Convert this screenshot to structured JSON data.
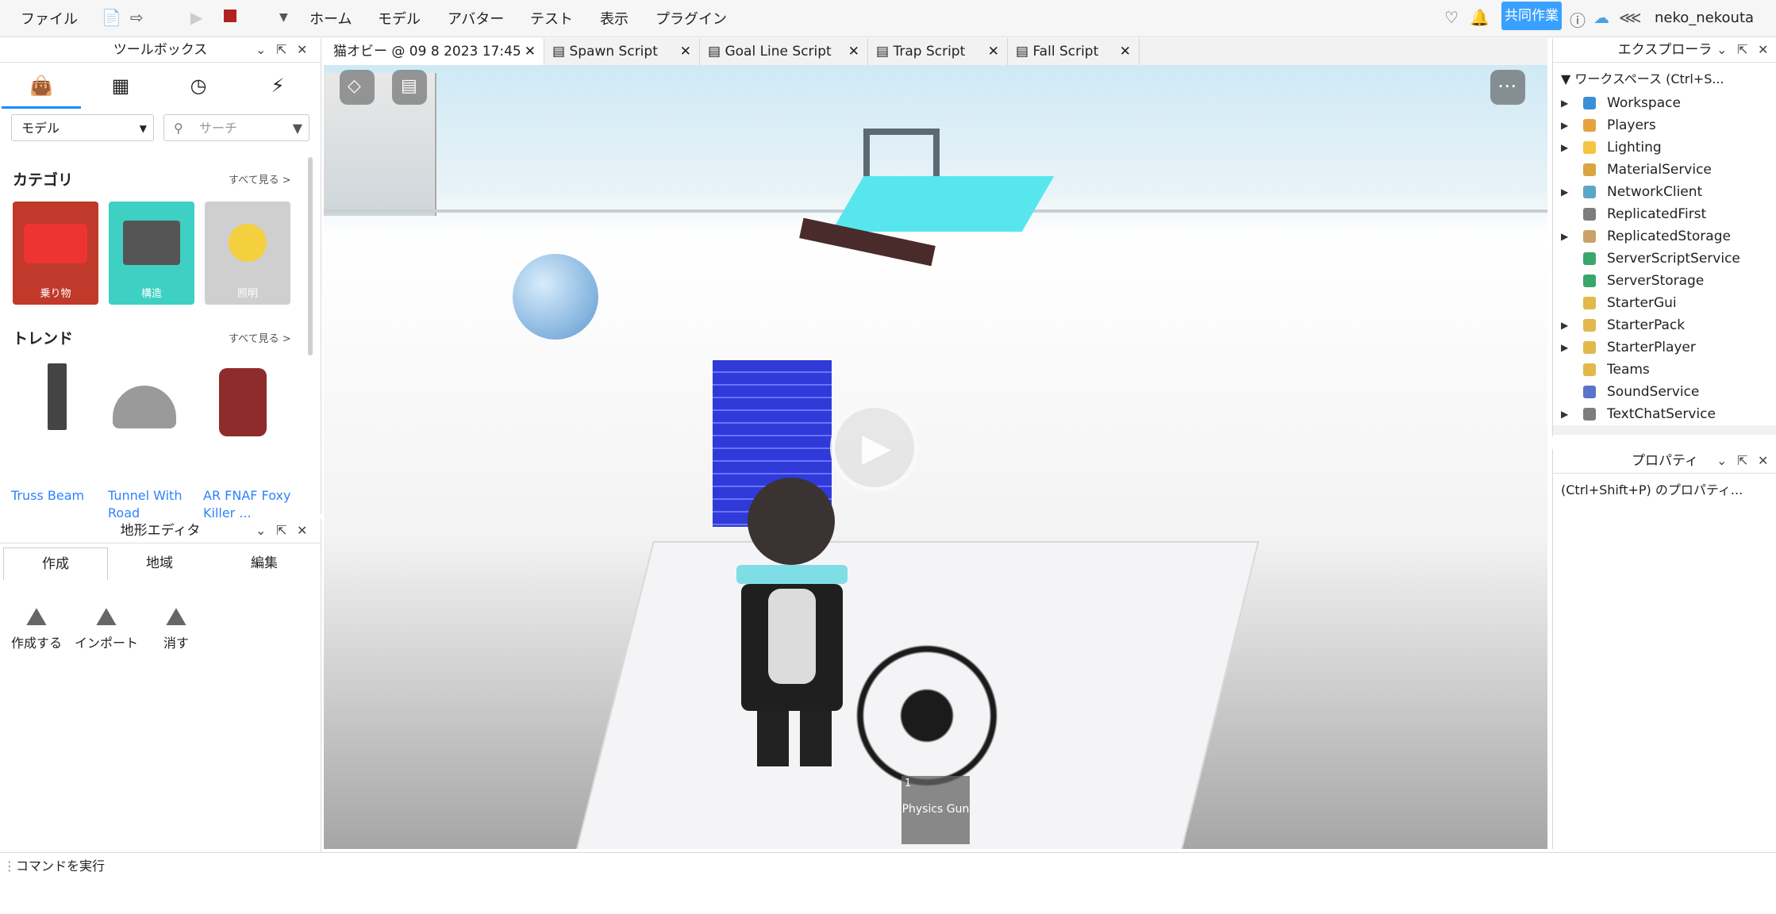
{
  "menu": {
    "file": "ファイル",
    "items": [
      "ホーム",
      "モデル",
      "アバター",
      "テスト",
      "表示",
      "プラグイン"
    ],
    "collab_button": "共同作業",
    "username": "neko_nekouta"
  },
  "toolbox": {
    "title": "ツールボックス",
    "dropdown_value": "モデル",
    "search_placeholder": "サーチ",
    "category_title": "カテゴリ",
    "see_all": "すべて見る >",
    "categories": [
      "乗り物",
      "構造",
      "照明"
    ],
    "trend_title": "トレンド",
    "trends": [
      "Truss Beam",
      "Tunnel With Road",
      "AR FNAF Foxy Killer ..."
    ]
  },
  "terrain": {
    "title": "地形エディタ",
    "tabs": [
      "作成",
      "地域",
      "編集"
    ],
    "tools": [
      "作成する",
      "インポート",
      "消す"
    ]
  },
  "tabs": [
    {
      "label": "猫オビー @ 09 8 2023 17:45"
    },
    {
      "label": "Spawn Script"
    },
    {
      "label": "Goal Line Script"
    },
    {
      "label": "Trap Script"
    },
    {
      "label": "Fall Script"
    }
  ],
  "viewport": {
    "hotbar_slot": "1",
    "hotbar_item": "Physics Gun"
  },
  "explorer": {
    "title": "エクスプローラ",
    "filter_placeholder": "ワークスペース (Ctrl+S...",
    "items": [
      {
        "label": "Workspace",
        "expand": true,
        "color": "#3b8fd6"
      },
      {
        "label": "Players",
        "expand": true,
        "color": "#e6a23c"
      },
      {
        "label": "Lighting",
        "expand": true,
        "color": "#f5c542"
      },
      {
        "label": "MaterialService",
        "expand": false,
        "color": "#d9a441"
      },
      {
        "label": "NetworkClient",
        "expand": true,
        "color": "#5aa7c9"
      },
      {
        "label": "ReplicatedFirst",
        "expand": false,
        "color": "#7d7d7d"
      },
      {
        "label": "ReplicatedStorage",
        "expand": true,
        "color": "#c9a36b"
      },
      {
        "label": "ServerScriptService",
        "expand": false,
        "color": "#3aa66b"
      },
      {
        "label": "ServerStorage",
        "expand": false,
        "color": "#3aa66b"
      },
      {
        "label": "StarterGui",
        "expand": false,
        "color": "#e2b84b"
      },
      {
        "label": "StarterPack",
        "expand": true,
        "color": "#e2b84b"
      },
      {
        "label": "StarterPlayer",
        "expand": true,
        "color": "#e2b84b"
      },
      {
        "label": "Teams",
        "expand": false,
        "color": "#e2b84b"
      },
      {
        "label": "SoundService",
        "expand": false,
        "color": "#5a74c9"
      },
      {
        "label": "TextChatService",
        "expand": true,
        "color": "#7d7d7d"
      }
    ]
  },
  "properties": {
    "title": "プロパティ",
    "filter_placeholder": "(Ctrl+Shift+P) のプロパティ..."
  },
  "command_bar": {
    "placeholder": "コマンドを実行"
  }
}
